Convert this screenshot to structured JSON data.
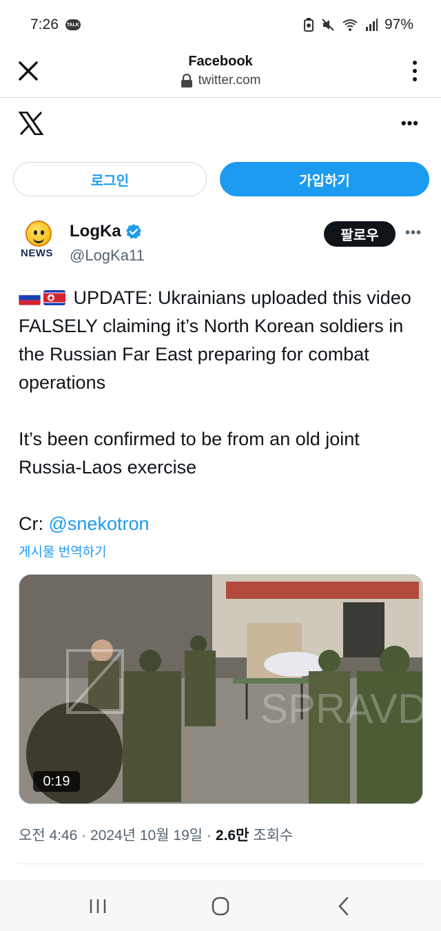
{
  "status_bar": {
    "time": "7:26",
    "talk_label": "TALK",
    "battery": "97%"
  },
  "browser": {
    "title": "Facebook",
    "url": "twitter.com"
  },
  "auth": {
    "login_label": "로그인",
    "signup_label": "가입하기"
  },
  "tweet": {
    "avatar_text": "NEWS",
    "display_name": "LogKa",
    "handle": "@LogKa11",
    "follow_label": "팔로우",
    "text_line1": "UPDATE: Ukrainians uploaded this video FALSELY claiming it’s North Korean soldiers in the Russian Far East preparing for combat operations",
    "text_line2": "It’s been confirmed to be from an old joint Russia-Laos exercise",
    "credit_prefix": "Cr: ",
    "credit_mention": "@snekotron",
    "translate_label": "게시물 번역하기",
    "video_duration": "0:19",
    "video_watermark": "SPRAVDI",
    "timestamp": "오전 4:46 · 2024년 10월 19일 · ",
    "views_count": "2.6만",
    "views_label": "조회수"
  },
  "colors": {
    "accent": "#1d9bf0",
    "text": "#0f1419",
    "secondary": "#536471"
  }
}
